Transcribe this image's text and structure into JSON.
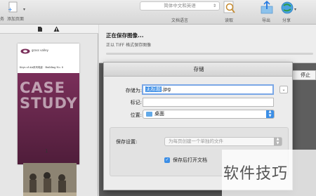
{
  "toolbar": {
    "partial_left_label": "务",
    "add_page_label": "添加页面",
    "language_value": "简体中文和英语",
    "language_label": "文档语言",
    "read_label": "读取",
    "export_label": "导出",
    "share_label": "分享"
  },
  "sidebar": {
    "thumbnail_logo_text": "grass valley",
    "thumbnail_subtitle": "Keys of AA系列电影 · Building No. 8",
    "thumbnail_cover_text_1": "CASE",
    "thumbnail_cover_text_2": "STUDY",
    "page_number": "1"
  },
  "progress": {
    "title": "正在保存图像...",
    "subtitle": "正以 TIFF 格式保存图像",
    "stop_label": "停止",
    "fraction": 0.0
  },
  "dialog": {
    "title": "存储",
    "save_as_label": "存储为:",
    "filename_selected": "无标题",
    "filename_ext": ".jpg",
    "tags_label": "标记:",
    "tags_value": "",
    "location_label": "位置:",
    "location_value": "桌面",
    "save_settings_label": "保存设置:",
    "save_settings_value": "为每页创建一个单独的文件",
    "open_after_save_label": "保存后打开文档",
    "open_after_save_checked": true
  },
  "watermark": {
    "text": "软件技巧"
  },
  "colors": {
    "accent": "#3b8ee6",
    "cover_band": "#7a2f5a"
  }
}
